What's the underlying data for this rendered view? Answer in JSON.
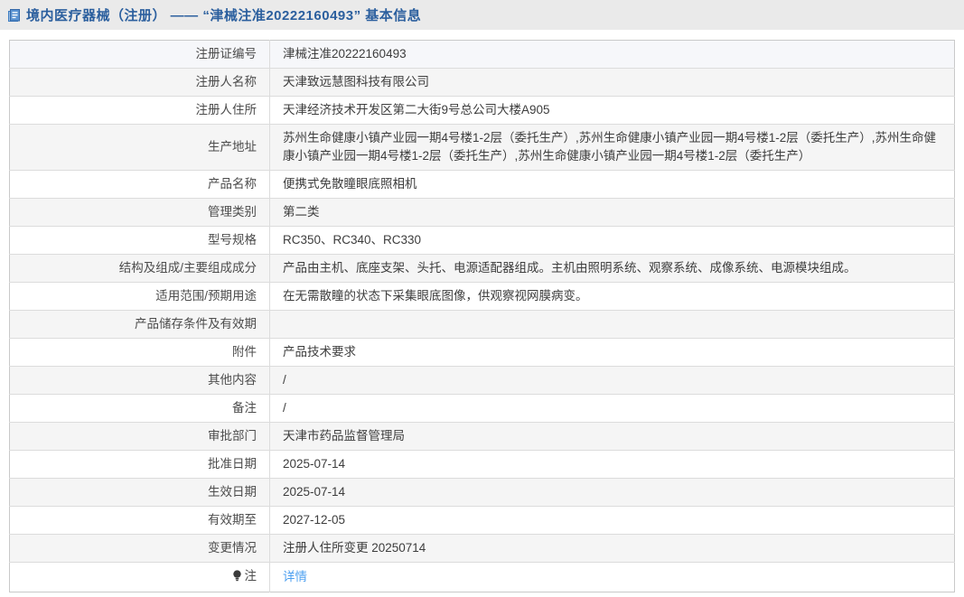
{
  "header": {
    "icon": "document-icon",
    "title": "境内医疗器械（注册） —— “津械注准20222160493” 基本信息"
  },
  "colors": {
    "topbar_background": "#eaeaea",
    "title_blue": "#2b5f9e",
    "link_blue": "#4da0f0",
    "shaded_row": "#f5f5f5",
    "first_row": "#f6f7fa",
    "table_border": "#c9c9c9"
  },
  "table": {
    "rows": [
      {
        "label": "注册证编号",
        "value": "津械注准20222160493"
      },
      {
        "label": "注册人名称",
        "value": "天津致远慧图科技有限公司"
      },
      {
        "label": "注册人住所",
        "value": "天津经济技术开发区第二大街9号总公司大楼A905"
      },
      {
        "label": "生产地址",
        "value": "苏州生命健康小镇产业园一期4号楼1-2层（委托生产）,苏州生命健康小镇产业园一期4号楼1-2层（委托生产）,苏州生命健康小镇产业园一期4号楼1-2层（委托生产）,苏州生命健康小镇产业园一期4号楼1-2层（委托生产）"
      },
      {
        "label": "产品名称",
        "value": "便携式免散瞳眼底照相机"
      },
      {
        "label": "管理类别",
        "value": "第二类"
      },
      {
        "label": "型号规格",
        "value": "RC350、RC340、RC330"
      },
      {
        "label": "结构及组成/主要组成成分",
        "value": "产品由主机、底座支架、头托、电源适配器组成。主机由照明系统、观察系统、成像系统、电源模块组成。"
      },
      {
        "label": "适用范围/预期用途",
        "value": "在无需散瞳的状态下采集眼底图像，供观察视网膜病变。"
      },
      {
        "label": "产品储存条件及有效期",
        "value": ""
      },
      {
        "label": "附件",
        "value": "产品技术要求"
      },
      {
        "label": "其他内容",
        "value": "/"
      },
      {
        "label": "备注",
        "value": "/"
      },
      {
        "label": "审批部门",
        "value": "天津市药品监督管理局"
      },
      {
        "label": "批准日期",
        "value": "2025-07-14"
      },
      {
        "label": "生效日期",
        "value": "2025-07-14"
      },
      {
        "label": "有效期至",
        "value": "2027-12-05"
      },
      {
        "label": "变更情况",
        "value": "注册人住所变更 20250714"
      },
      {
        "label": "注",
        "value": "详情",
        "value_is_link": true,
        "label_icon": "bulb-icon"
      }
    ]
  }
}
